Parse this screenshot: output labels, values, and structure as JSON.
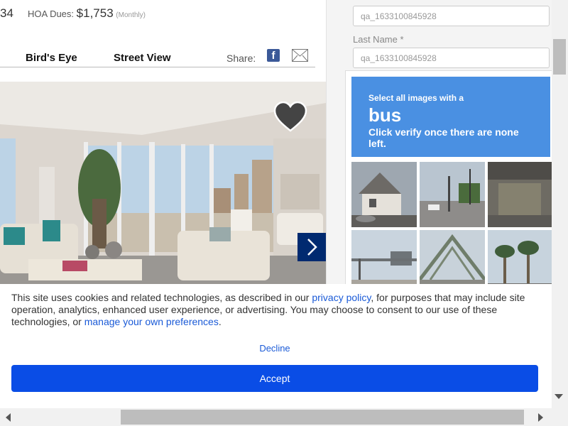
{
  "listing": {
    "price_fragment": "34",
    "hoa_label": "HOA Dues:",
    "hoa_amount": "$1,753",
    "hoa_period": "(Monthly)",
    "tabs": [
      "Bird's Eye",
      "Street View"
    ],
    "share_label": "Share:",
    "share_icons": [
      "facebook-icon",
      "mail-icon"
    ],
    "favorite_icon": "heart-icon",
    "next_icon": "chevron-right-icon"
  },
  "form": {
    "first_name_value": "qa_1633100845928",
    "last_name_label": "Last Name *",
    "last_name_value": "qa_1633100845928"
  },
  "captcha": {
    "instruction": "Select all images with a",
    "target": "bus",
    "hint": "Click verify once there are none left.",
    "header_color": "#4a90e2"
  },
  "cookie": {
    "text_1": "This site uses cookies and related technologies, as described in our ",
    "privacy_link": "privacy policy",
    "text_2": ", for purposes that may include site operation, analytics, enhanced user experience, or advertising. You may choose to consent to our use of these technologies, or ",
    "preferences_link": "manage your own preferences",
    "text_3": ".",
    "decline_label": "Decline",
    "accept_label": "Accept",
    "accent_color": "#0a4de6"
  }
}
